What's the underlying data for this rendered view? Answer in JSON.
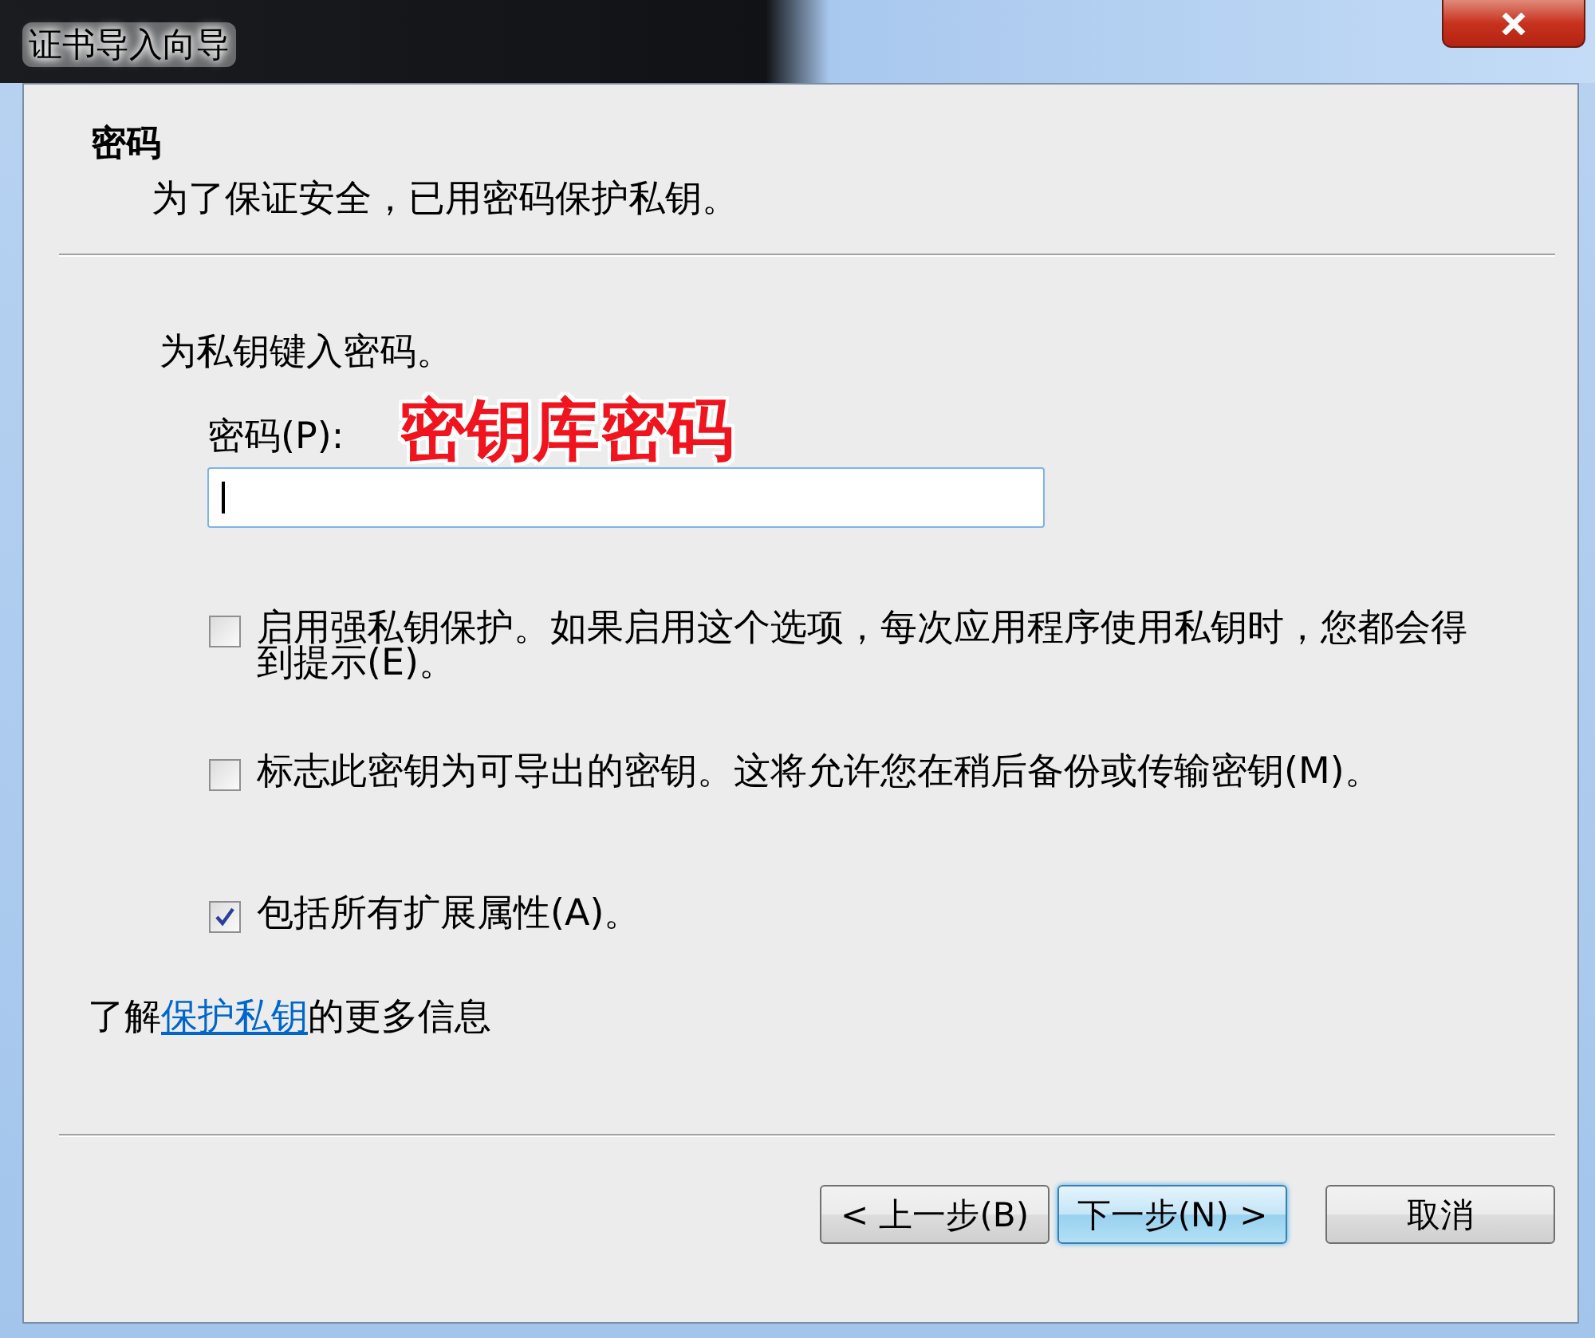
{
  "window": {
    "title": "证书导入向导"
  },
  "header": {
    "title": "密码",
    "subtitle": "为了保证安全，已用密码保护私钥。"
  },
  "intro": "为私钥键入密码。",
  "password": {
    "label": "密码(P):",
    "focused": true
  },
  "annotation": "密钥库密码",
  "options": [
    {
      "label": "启用强私钥保护。如果启用这个选项，每次应用程序使用私钥时，您都会得到提示(E)。",
      "checked": false
    },
    {
      "label": "标志此密钥为可导出的密钥。这将允许您在稍后备份或传输密钥(M)。",
      "checked": false
    },
    {
      "label": "包括所有扩展属性(A)。",
      "checked": true
    }
  ],
  "help_parts": {
    "before": "了解",
    "link": "保护私钥",
    "after": "的更多信息"
  },
  "buttons": [
    {
      "label": "< 上一步(B)",
      "focused": false
    },
    {
      "label": "下一步(N) >",
      "focused": true
    },
    {
      "label": "取消",
      "focused": false
    }
  ]
}
